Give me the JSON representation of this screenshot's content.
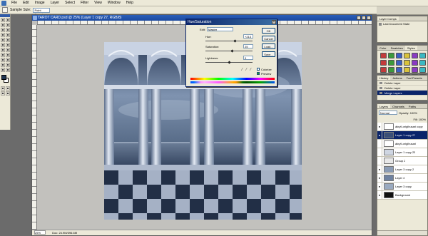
{
  "menu": [
    "File",
    "Edit",
    "Image",
    "Layer",
    "Select",
    "Filter",
    "View",
    "Window",
    "Help"
  ],
  "options": {
    "sample_label": "Sample Size:",
    "sample_value": "Point Sample"
  },
  "document": {
    "title": "TAROT CARD.psd @ 25% (Layer 1 copy 27, RGB/8)",
    "zoom": "25%",
    "status": "Doc: 24.9M/396.6M"
  },
  "dialog": {
    "title": "Hue/Saturation",
    "edit_label": "Edit:",
    "edit_value": "Master",
    "hue_label": "Hue:",
    "hue_value": "+213",
    "saturation_label": "Saturation:",
    "saturation_value": "25",
    "lightness_label": "Lightness:",
    "lightness_value": "0",
    "hue_position": 0.62,
    "saturation_position": 0.56,
    "lightness_position": 0.5,
    "ok_label": "OK",
    "cancel_label": "Cancel",
    "load_label": "Load...",
    "save_label": "Save...",
    "colorize_label": "Colorize",
    "colorize_checked": false,
    "preview_label": "Preview",
    "preview_checked": true
  },
  "navigator": {
    "tabs": [
      "Layer Comps"
    ],
    "item": "Last Document State"
  },
  "swatches": {
    "tabs": [
      "Color",
      "Swatches",
      "Styles"
    ],
    "colors": [
      "#c23b3b",
      "#3b9a3b",
      "#3b5fc2",
      "#d8c23b",
      "#8a3bc2",
      "#3bb8c2",
      "#c23b3b",
      "#3b9a3b",
      "#3b5fc2",
      "#d8c23b",
      "#8a3bc2",
      "#3bb8c2",
      "#c23b3b",
      "#3b9a3b",
      "#3b5fc2",
      "#d8c23b",
      "#8a3bc2",
      "#3bb8c2",
      "#c23b3b",
      "#3b9a3b",
      "#3b5fc2",
      "#d8c23b",
      "#8a3bc2",
      "#3bb8c2"
    ]
  },
  "history": {
    "tabs": [
      "History",
      "Actions",
      "Tool Presets"
    ],
    "items": [
      {
        "label": "Delete Layer",
        "selected": false
      },
      {
        "label": "Delete Layer",
        "selected": false
      },
      {
        "label": "Merge Layers",
        "selected": true
      }
    ]
  },
  "layers": {
    "tabs": [
      "Layers",
      "Channels",
      "Paths"
    ],
    "mode": "Normal",
    "opacity": "Opacity: 100%",
    "fill": "Fill: 100%",
    "items": [
      {
        "name": "ákryil-origihusari copy",
        "visible": true,
        "selected": false,
        "thumb": "#ffffff"
      },
      {
        "name": "Layer 1 copy 27",
        "visible": true,
        "selected": true,
        "thumb": "#3a4f78"
      },
      {
        "name": "ákryil-origihusari",
        "visible": false,
        "selected": false,
        "thumb": "#ffffff"
      },
      {
        "name": "Layer 1 copy 25",
        "visible": false,
        "selected": false,
        "thumb": "#cfd6e2"
      },
      {
        "name": "Group 2",
        "visible": false,
        "selected": false,
        "thumb": "#e8e8e8"
      },
      {
        "name": "Layer 3 copy 2",
        "visible": true,
        "selected": false,
        "thumb": "#8b9cb5"
      },
      {
        "name": "Layer 4",
        "visible": true,
        "selected": false,
        "thumb": "#6f82a0"
      },
      {
        "name": "Layer 3 copy",
        "visible": true,
        "selected": false,
        "thumb": "#9aaac0"
      },
      {
        "name": "Background",
        "visible": true,
        "selected": false,
        "thumb": "#111111"
      }
    ]
  }
}
